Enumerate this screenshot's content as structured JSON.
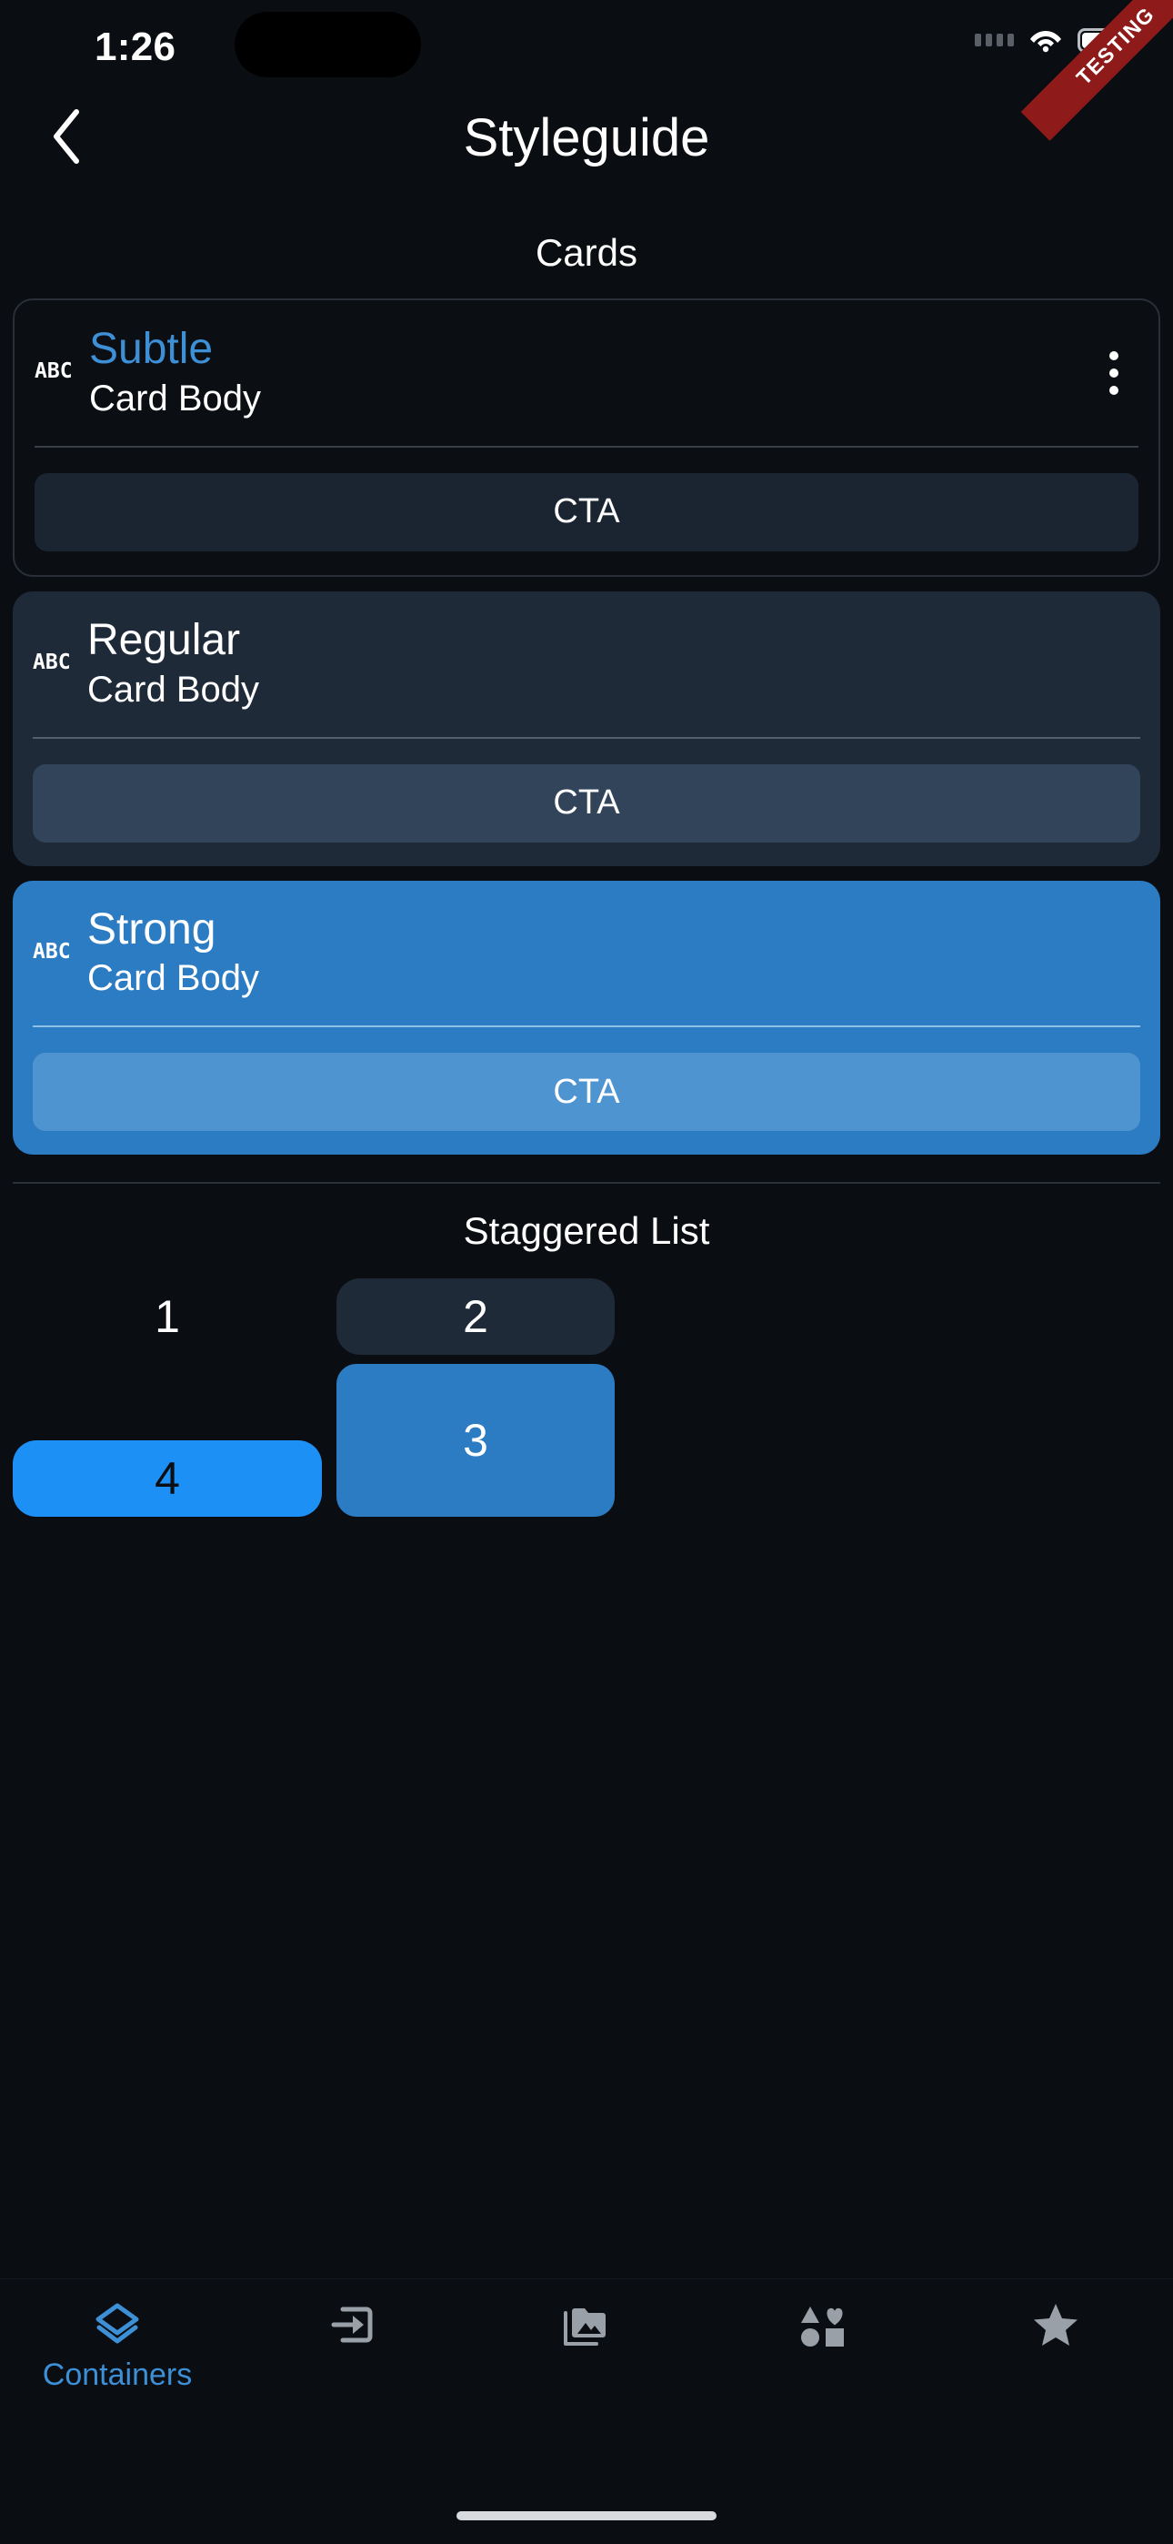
{
  "statusbar": {
    "time": "1:26",
    "signal_icon": "signal-dots-icon",
    "wifi_icon": "wifi-icon",
    "battery_icon": "battery-icon",
    "ribbon_label": "TESTING",
    "ribbon_color": "#8e1a1a"
  },
  "navbar": {
    "back_icon": "chevron-left-icon",
    "title": "Styleguide"
  },
  "theme": {
    "background": "#0a0d12",
    "accent": "#3d8fd6",
    "strong_blue": "#2c7cc3",
    "bright_blue": "#1d90f5",
    "surface_regular": "#1e2a38"
  },
  "sections": {
    "cards_header": "Cards",
    "staggered_header": "Staggered List"
  },
  "cards": [
    {
      "variant": "subtle",
      "leading_icon": "ABC",
      "title": "Subtle",
      "body": "Card Body",
      "cta_label": "CTA",
      "has_menu": true,
      "menu_icon": "more-vertical-icon"
    },
    {
      "variant": "regular",
      "leading_icon": "ABC",
      "title": "Regular",
      "body": "Card Body",
      "cta_label": "CTA",
      "has_menu": false
    },
    {
      "variant": "strong",
      "leading_icon": "ABC",
      "title": "Strong",
      "body": "Card Body",
      "cta_label": "CTA",
      "has_menu": false
    }
  ],
  "staggered_list": [
    {
      "label": "1",
      "style": "subtle"
    },
    {
      "label": "2",
      "style": "regular"
    },
    {
      "label": "3",
      "style": "strong"
    },
    {
      "label": "4",
      "style": "bright"
    }
  ],
  "tabbar": {
    "items": [
      {
        "label": "Containers",
        "icon": "layers-icon",
        "active": true
      },
      {
        "label": "",
        "icon": "input-arrow-icon",
        "active": false
      },
      {
        "label": "",
        "icon": "photo-library-icon",
        "active": false
      },
      {
        "label": "",
        "icon": "shapes-icon",
        "active": false
      },
      {
        "label": "",
        "icon": "star-icon",
        "active": false
      }
    ]
  }
}
